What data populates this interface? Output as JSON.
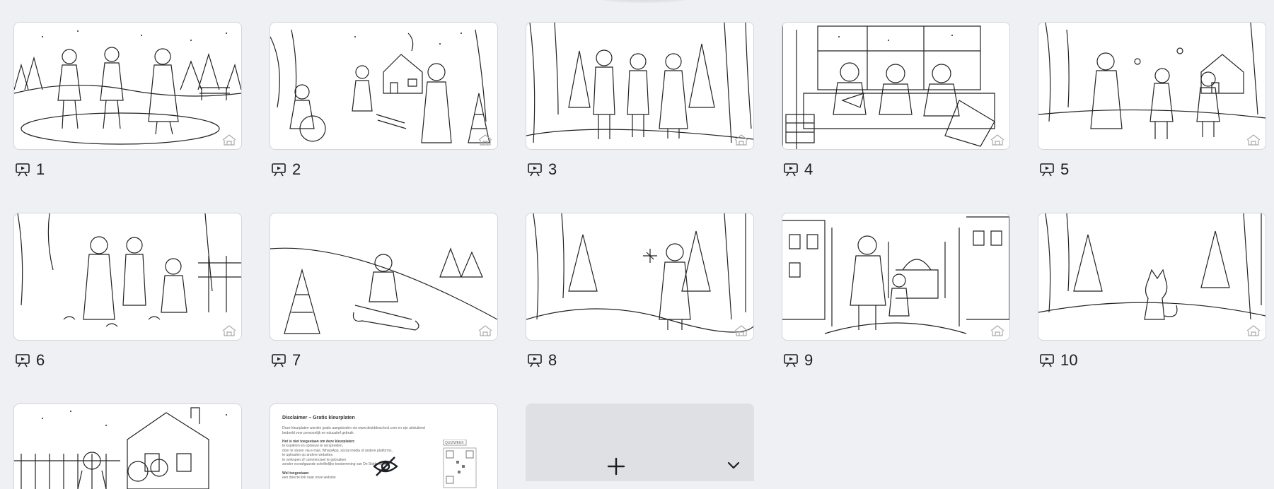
{
  "slides": [
    {
      "number": "1",
      "scene": "ice-skating"
    },
    {
      "number": "2",
      "scene": "snowman-sled-house"
    },
    {
      "number": "3",
      "scene": "forest-walk"
    },
    {
      "number": "4",
      "scene": "reading-indoors"
    },
    {
      "number": "5",
      "scene": "snowball-fight"
    },
    {
      "number": "6",
      "scene": "feeding-birds"
    },
    {
      "number": "7",
      "scene": "sledding-hill"
    },
    {
      "number": "8",
      "scene": "snowflake-path"
    },
    {
      "number": "9",
      "scene": "city-mosque"
    },
    {
      "number": "10",
      "scene": "fox-in-forest"
    }
  ],
  "partial_slides": [
    {
      "scene": "house-snowman"
    },
    {
      "scene": "disclaimer",
      "hidden": true
    }
  ],
  "disclaimer": {
    "title": "Disclaimer – Gratis kleurplaten",
    "intro_line_1": "Deze kleurplaten worden gratis aangeboden via www.desiddeschool.com en zijn uitsluitend",
    "intro_line_2": "bedoeld voor persoonlijk en educatief gebruik.",
    "heading_not_allowed": "Het is niet toegestaan om deze kleurplaten:",
    "bullet_1": "te kopiëren en opnieuw te verspreiden,",
    "bullet_2": "door te sturen via e-mail, WhatsApp, social media of andere platforms,",
    "bullet_3": "te uploaden op andere websites,",
    "bullet_4": "te verkopen of commercieel te gebruiken",
    "bullet_5": "zonder voorafgaande schriftelijke toestemming van De Sidde School.",
    "heading_allowed": "Wel toegestaan:",
    "allowed_1": "een directe link naar onze website",
    "qr_label": "QUIZWEEK"
  },
  "add_tile": {
    "plus_icon": "plus-icon",
    "chevron_icon": "chevron-down-icon"
  },
  "colors": {
    "background": "#eff0f3",
    "thumb_border": "#d3d5db",
    "add_tile": "#dfe0e4",
    "text": "#1b1e24"
  }
}
